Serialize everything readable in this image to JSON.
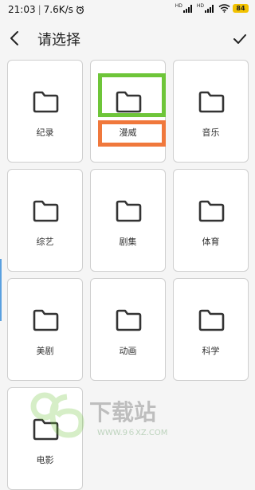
{
  "status_bar": {
    "time": "21:03",
    "speed": "7.6K/s",
    "hd_left": "HD",
    "hd_right": "HD",
    "battery": "84"
  },
  "header": {
    "title": "请选择"
  },
  "folders": [
    {
      "label": "纪录"
    },
    {
      "label": "漫威"
    },
    {
      "label": "音乐"
    },
    {
      "label": "综艺"
    },
    {
      "label": "剧集"
    },
    {
      "label": "体育"
    },
    {
      "label": "美剧"
    },
    {
      "label": "动画"
    },
    {
      "label": "科学"
    },
    {
      "label": "电影"
    }
  ],
  "watermark": {
    "text": "下载站",
    "url": "WWW.9６XZ.COM"
  },
  "colors": {
    "highlight_green": "#6ec539",
    "highlight_orange": "#f0783c",
    "battery": "#f2c200"
  }
}
